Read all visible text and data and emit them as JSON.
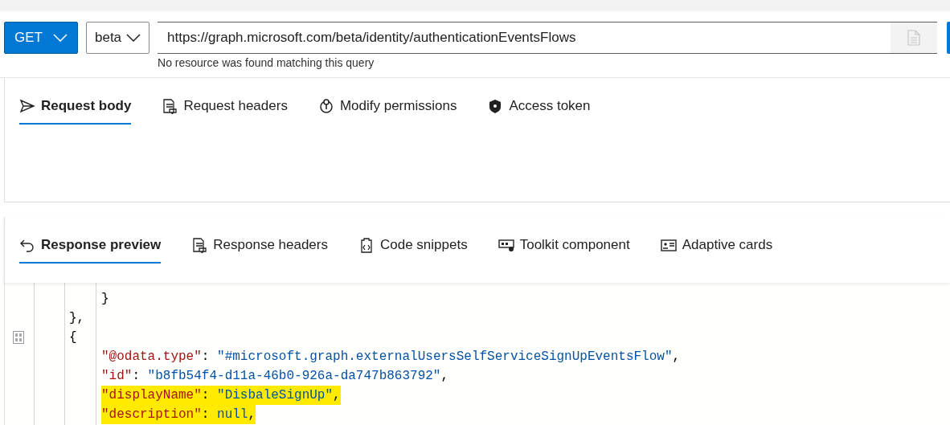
{
  "query_bar": {
    "method": "GET",
    "version": "beta",
    "url": "https://graph.microsoft.com/beta/identity/authenticationEventsFlows",
    "hint": "No resource was found matching this query"
  },
  "request_tabs": [
    {
      "label": "Request body",
      "selected": true
    },
    {
      "label": "Request headers",
      "selected": false
    },
    {
      "label": "Modify permissions",
      "selected": false
    },
    {
      "label": "Access token",
      "selected": false
    }
  ],
  "response_tabs": [
    {
      "label": "Response preview",
      "selected": true
    },
    {
      "label": "Response headers",
      "selected": false
    },
    {
      "label": "Code snippets",
      "selected": false
    },
    {
      "label": "Toolkit component",
      "selected": false
    },
    {
      "label": "Adaptive cards",
      "selected": false
    }
  ],
  "code_lines": [
    {
      "children": [
        {
          "marker": false,
          "tokens": [
            {
              "kind": "punct",
              "text": "}"
            }
          ]
        }
      ]
    },
    {
      "marker": false,
      "tokens": [
        {
          "kind": "punct",
          "text": "},"
        }
      ]
    },
    {
      "marker": true,
      "tokens": [
        {
          "kind": "punct",
          "text": "{"
        }
      ],
      "children": [
        {
          "marker": false,
          "highlighted": false,
          "tokens": [
            {
              "kind": "key",
              "text": "\"@odata.type\""
            },
            {
              "kind": "punct",
              "text": ": "
            },
            {
              "kind": "string",
              "text": "\"#microsoft.graph.externalUsersSelfServiceSignUpEventsFlow\""
            },
            {
              "kind": "punct",
              "text": ","
            }
          ]
        },
        {
          "marker": false,
          "highlighted": false,
          "tokens": [
            {
              "kind": "key",
              "text": "\"id\""
            },
            {
              "kind": "punct",
              "text": ": "
            },
            {
              "kind": "string",
              "text": "\"b8fb54f4-d11a-46b0-926a-da747b863792\""
            },
            {
              "kind": "punct",
              "text": ","
            }
          ]
        },
        {
          "marker": false,
          "highlighted": true,
          "tokens": [
            {
              "kind": "key",
              "text": "\"displayName\""
            },
            {
              "kind": "punct",
              "text": ": "
            },
            {
              "kind": "value",
              "text": "\"DisbaleSignUp\""
            },
            {
              "kind": "punct",
              "text": ","
            }
          ]
        },
        {
          "marker": false,
          "highlighted": true,
          "tokens": [
            {
              "kind": "key",
              "text": "\"description\""
            },
            {
              "kind": "punct",
              "text": ": "
            },
            {
              "kind": "null",
              "text": "null"
            },
            {
              "kind": "punct",
              "text": ","
            }
          ]
        }
      ]
    }
  ]
}
